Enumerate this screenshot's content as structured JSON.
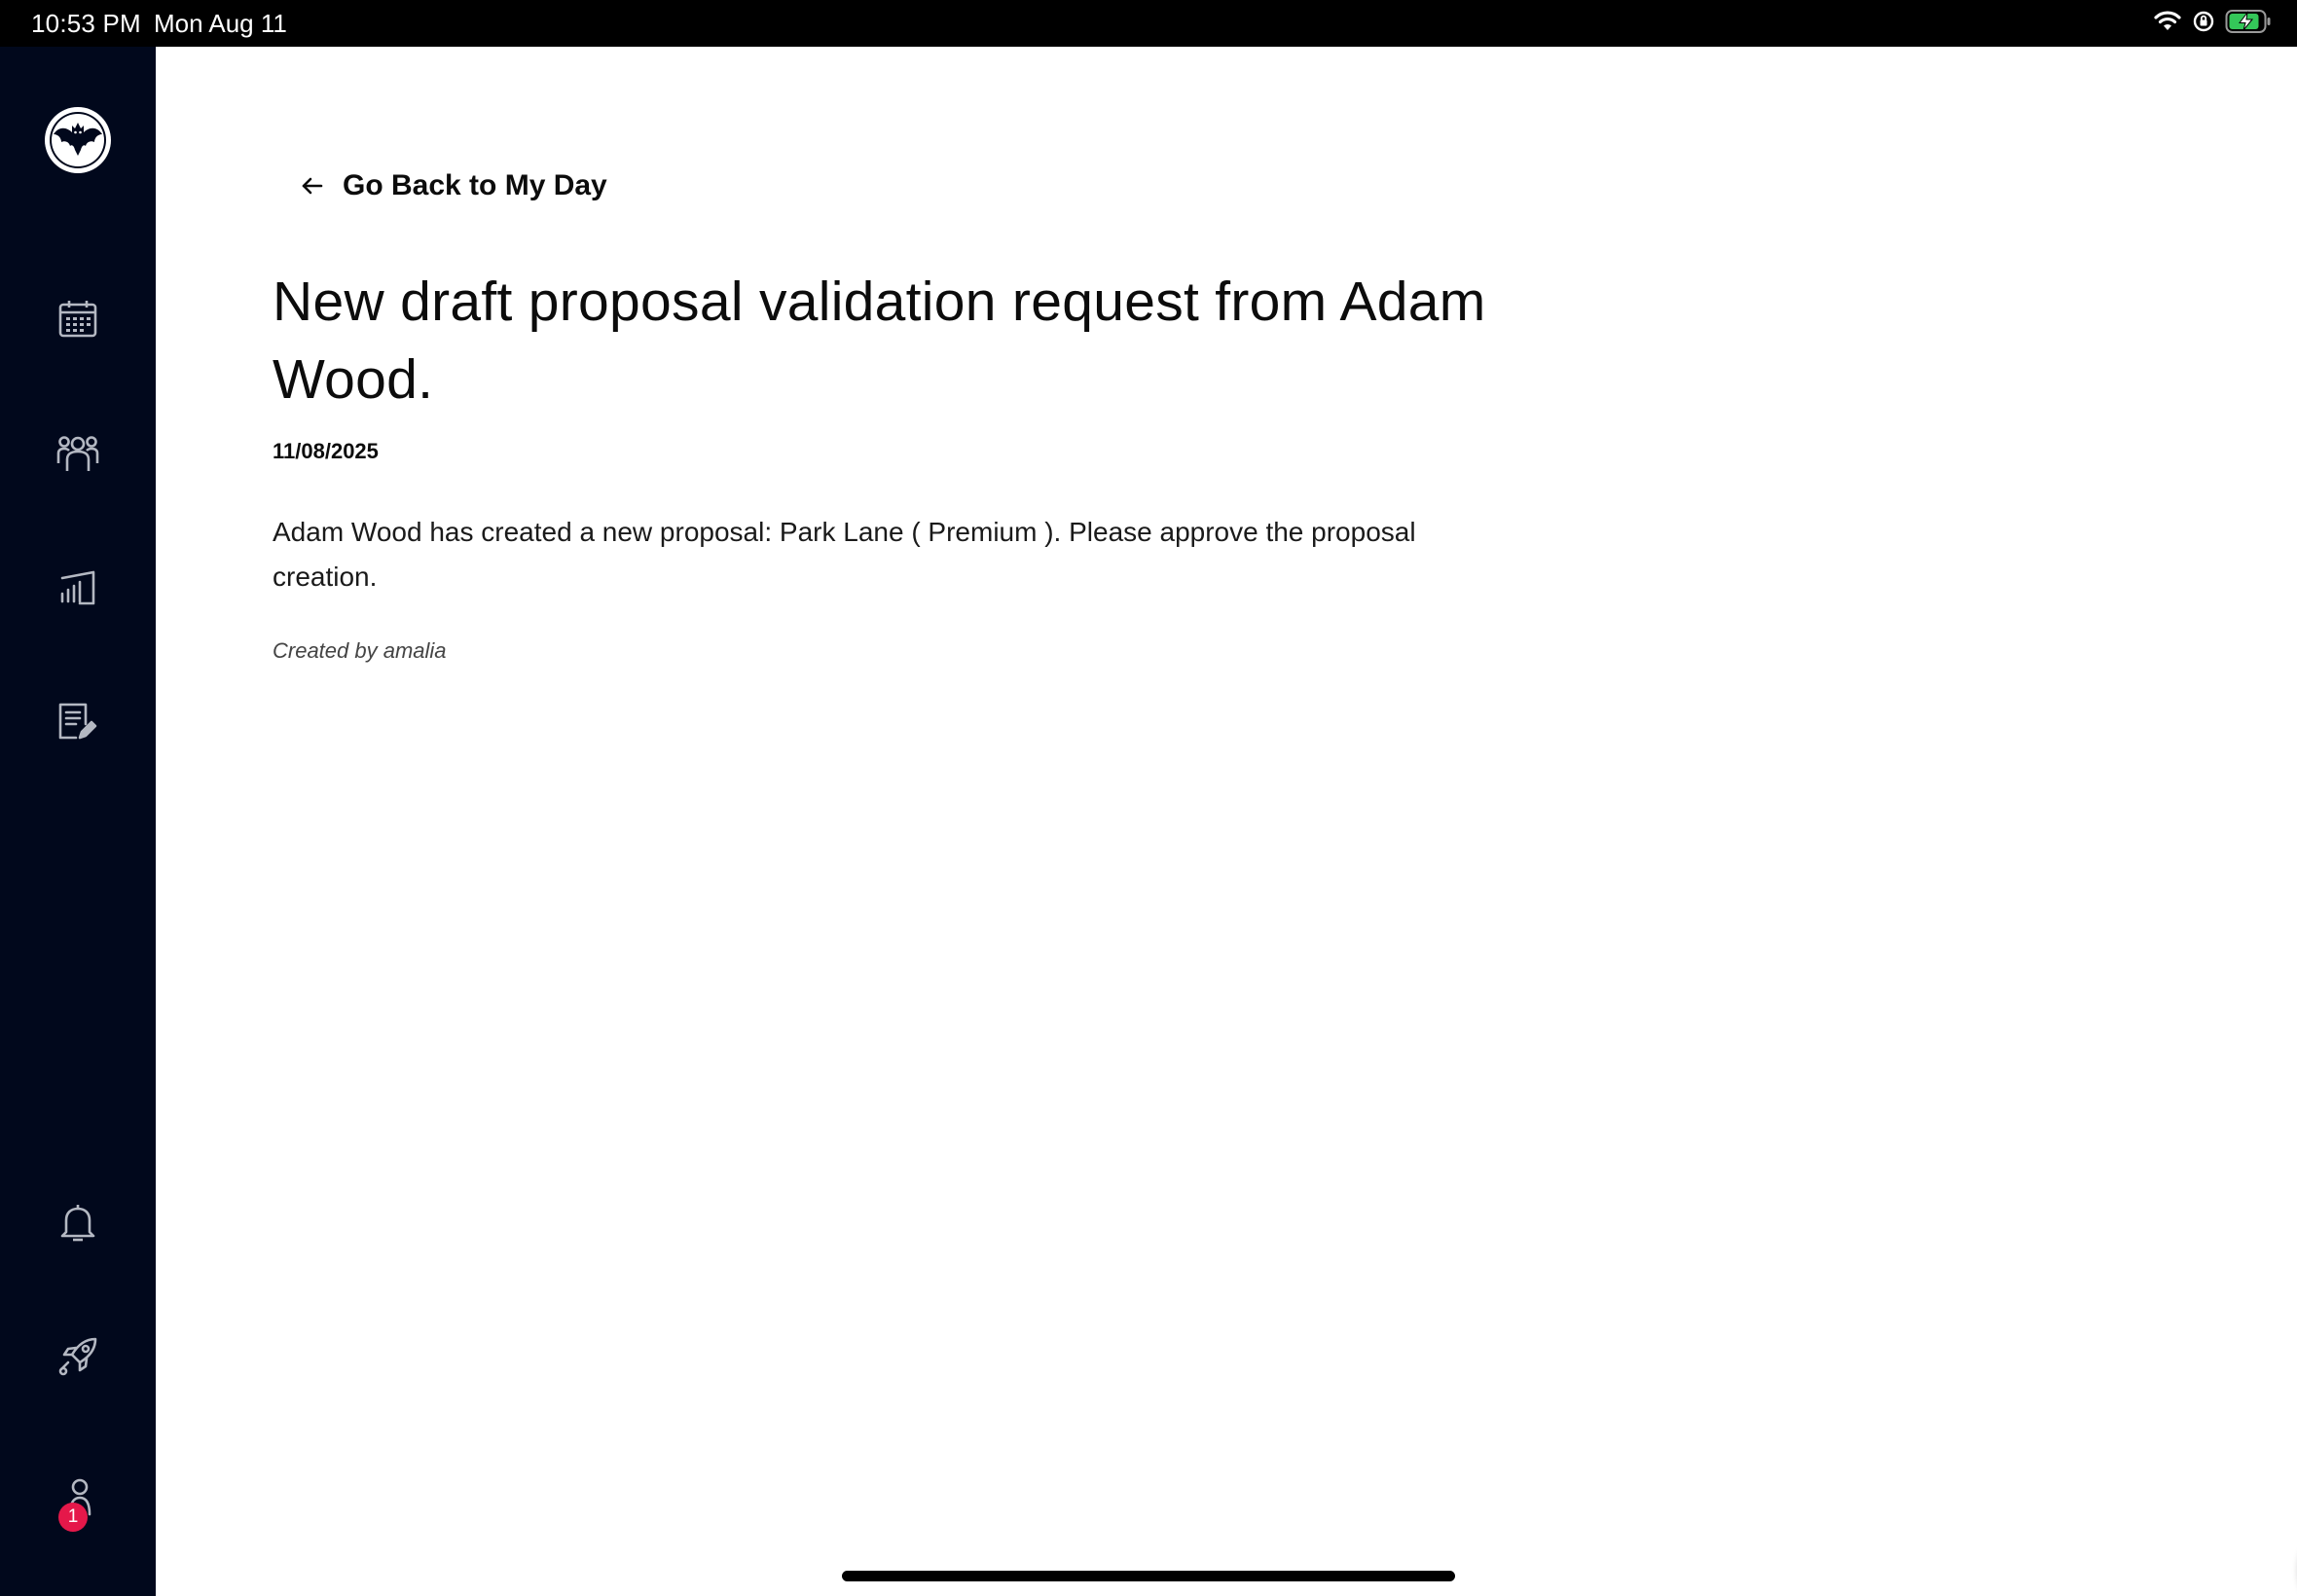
{
  "status_bar": {
    "time": "10:53 PM",
    "date": "Mon Aug 11",
    "icons": [
      "wifi-icon",
      "orientation-lock-icon",
      "battery-charging-icon"
    ],
    "battery_color": "#34c759"
  },
  "sidebar": {
    "background": "#01081c",
    "items": [
      {
        "name": "calendar",
        "icon": "calendar-icon"
      },
      {
        "name": "customers",
        "icon": "people-icon"
      },
      {
        "name": "reports",
        "icon": "bar-chart-icon"
      },
      {
        "name": "proposals",
        "icon": "document-edit-icon"
      },
      {
        "name": "notifications",
        "icon": "bell-icon"
      },
      {
        "name": "launch",
        "icon": "rocket-icon"
      },
      {
        "name": "profile",
        "icon": "user-icon",
        "badge": "1"
      }
    ],
    "badge_color": "#e5184a"
  },
  "main": {
    "back_link_label": "Go Back to My Day",
    "title": "New draft proposal validation request from Adam Wood.",
    "date": "11/08/2025",
    "body": "Adam Wood has created a new proposal: Park Lane ( Premium ). Please approve the proposal creation.",
    "created_by": "Created by amalia"
  },
  "fab": {
    "icon": "more-icon",
    "color": "#139ba1"
  }
}
